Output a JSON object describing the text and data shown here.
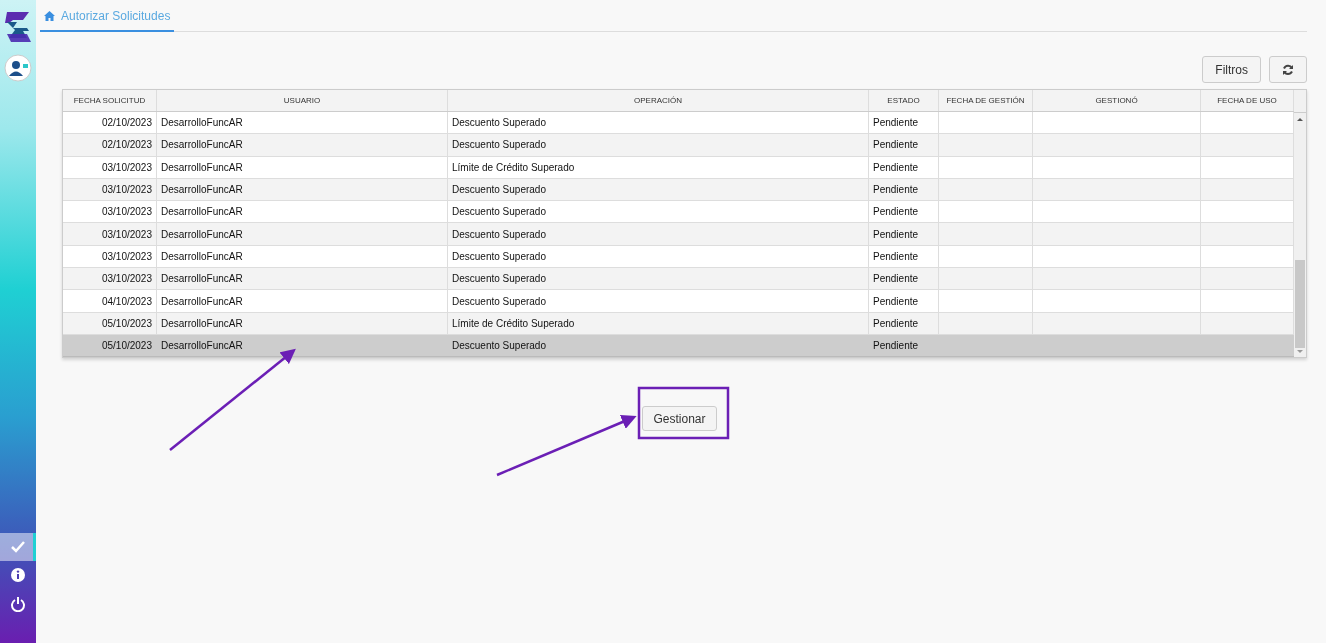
{
  "sidebar": {
    "items": [
      {
        "kind": "check",
        "selected": true
      },
      {
        "kind": "info",
        "selected": false
      },
      {
        "kind": "power",
        "selected": false
      }
    ]
  },
  "tabs": [
    {
      "label": "Autorizar Solicitudes",
      "selected": true
    }
  ],
  "toolbar": {
    "filter_button": "Filtros"
  },
  "table": {
    "columns": [
      "FECHA SOLICITUD",
      "USUARIO",
      "OPERACIÓN",
      "ESTADO",
      "FECHA DE GESTIÓN",
      "GESTIONÓ",
      "FECHA DE USO"
    ],
    "rows": [
      {
        "cells": [
          "02/10/2023",
          "DesarrolloFuncAR",
          "Descuento Superado",
          "Pendiente",
          "",
          "",
          ""
        ],
        "selected": false
      },
      {
        "cells": [
          "02/10/2023",
          "DesarrolloFuncAR",
          "Descuento Superado",
          "Pendiente",
          "",
          "",
          ""
        ],
        "selected": false
      },
      {
        "cells": [
          "03/10/2023",
          "DesarrolloFuncAR",
          "Límite de Crédito Superado",
          "Pendiente",
          "",
          "",
          ""
        ],
        "selected": false
      },
      {
        "cells": [
          "03/10/2023",
          "DesarrolloFuncAR",
          "Descuento Superado",
          "Pendiente",
          "",
          "",
          ""
        ],
        "selected": false
      },
      {
        "cells": [
          "03/10/2023",
          "DesarrolloFuncAR",
          "Descuento Superado",
          "Pendiente",
          "",
          "",
          ""
        ],
        "selected": false
      },
      {
        "cells": [
          "03/10/2023",
          "DesarrolloFuncAR",
          "Descuento Superado",
          "Pendiente",
          "",
          "",
          ""
        ],
        "selected": false
      },
      {
        "cells": [
          "03/10/2023",
          "DesarrolloFuncAR",
          "Descuento Superado",
          "Pendiente",
          "",
          "",
          ""
        ],
        "selected": false
      },
      {
        "cells": [
          "03/10/2023",
          "DesarrolloFuncAR",
          "Descuento Superado",
          "Pendiente",
          "",
          "",
          ""
        ],
        "selected": false
      },
      {
        "cells": [
          "04/10/2023",
          "DesarrolloFuncAR",
          "Descuento Superado",
          "Pendiente",
          "",
          "",
          ""
        ],
        "selected": false
      },
      {
        "cells": [
          "05/10/2023",
          "DesarrolloFuncAR",
          "Límite de Crédito Superado",
          "Pendiente",
          "",
          "",
          ""
        ],
        "selected": false
      },
      {
        "cells": [
          "05/10/2023",
          "DesarrolloFuncAR",
          "Descuento Superado",
          "Pendiente",
          "",
          "",
          ""
        ],
        "selected": true
      }
    ]
  },
  "action_button": "Gestionar"
}
